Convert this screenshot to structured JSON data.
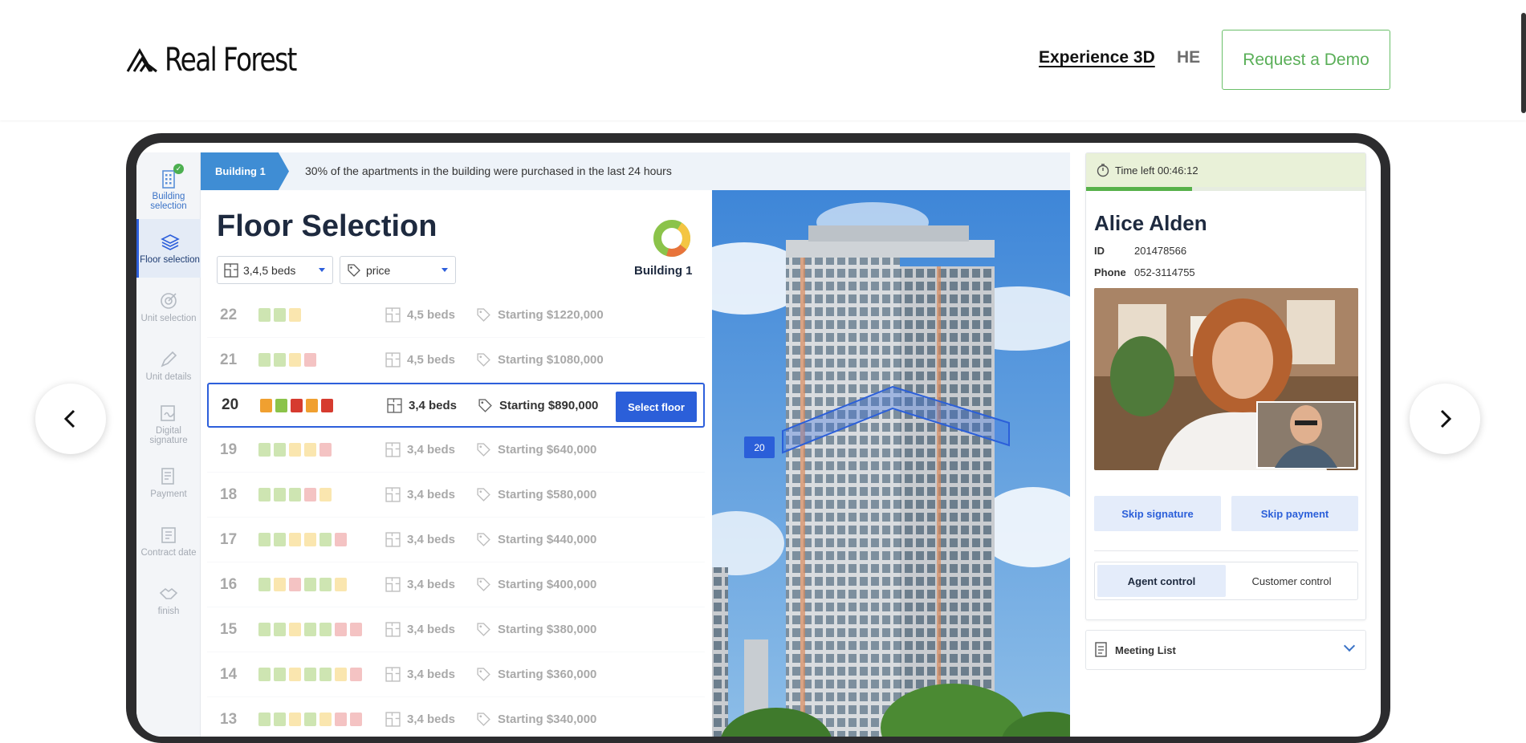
{
  "nav": {
    "brand": "Real Forest",
    "experience_link": "Experience 3D",
    "lang": "HE",
    "demo_button": "Request a Demo"
  },
  "steps": [
    {
      "label": "Building selection",
      "icon": "building-icon",
      "state": "done"
    },
    {
      "label": "Floor selection",
      "icon": "layers-icon",
      "state": "active"
    },
    {
      "label": "Unit selection",
      "icon": "target-icon",
      "state": "pending"
    },
    {
      "label": "Unit details",
      "icon": "pen-icon",
      "state": "pending"
    },
    {
      "label": "Digital signature",
      "icon": "signature-icon",
      "state": "pending"
    },
    {
      "label": "Payment",
      "icon": "payment-icon",
      "state": "pending"
    },
    {
      "label": "Contract date",
      "icon": "contract-icon",
      "state": "pending"
    },
    {
      "label": "finish",
      "icon": "handshake-icon",
      "state": "pending"
    }
  ],
  "announcement": {
    "building_tag": "Building 1",
    "text": "30% of the apartments in the building were purchased in the last 24 hours"
  },
  "floor_selection": {
    "title": "Floor Selection",
    "building_label": "Building 1",
    "filter_beds": "3,4,5 beds",
    "filter_price": "price",
    "select_button": "Select floor",
    "selected_floor": "20",
    "floors": [
      {
        "floor": "22",
        "beds": "4,5 beds",
        "price": "Starting $1220,000",
        "units": [
          "green",
          "green",
          "yellow"
        ]
      },
      {
        "floor": "21",
        "beds": "4,5 beds",
        "price": "Starting $1080,000",
        "units": [
          "green",
          "green",
          "yellow",
          "red"
        ]
      },
      {
        "floor": "20",
        "beds": "3,4 beds",
        "price": "Starting $890,000",
        "units": [
          "orange",
          "green",
          "darkred",
          "orange",
          "darkred"
        ]
      },
      {
        "floor": "19",
        "beds": "3,4 beds",
        "price": "Starting $640,000",
        "units": [
          "green",
          "green",
          "yellow",
          "yellow",
          "red"
        ]
      },
      {
        "floor": "18",
        "beds": "3,4 beds",
        "price": "Starting $580,000",
        "units": [
          "green",
          "green",
          "green",
          "red",
          "yellow"
        ]
      },
      {
        "floor": "17",
        "beds": "3,4 beds",
        "price": "Starting $440,000",
        "units": [
          "green",
          "green",
          "yellow",
          "yellow",
          "green",
          "red"
        ]
      },
      {
        "floor": "16",
        "beds": "3,4 beds",
        "price": "Starting $400,000",
        "units": [
          "green",
          "yellow",
          "red",
          "green",
          "green",
          "yellow"
        ]
      },
      {
        "floor": "15",
        "beds": "3,4 beds",
        "price": "Starting $380,000",
        "units": [
          "green",
          "green",
          "yellow",
          "green",
          "green",
          "red",
          "red"
        ]
      },
      {
        "floor": "14",
        "beds": "3,4 beds",
        "price": "Starting $360,000",
        "units": [
          "green",
          "green",
          "yellow",
          "green",
          "green",
          "yellow",
          "red"
        ]
      },
      {
        "floor": "13",
        "beds": "3,4 beds",
        "price": "Starting $340,000",
        "units": [
          "green",
          "green",
          "yellow",
          "green",
          "yellow",
          "red",
          "red"
        ]
      }
    ]
  },
  "building_view": {
    "floor_tag": "20"
  },
  "agent_panel": {
    "timer": "Time left 00:46:12",
    "timer_progress": 0.38,
    "customer_name": "Alice Alden",
    "id_label": "ID",
    "id_value": "201478566",
    "phone_label": "Phone",
    "phone_value": "052-3114755",
    "skip_signature": "Skip signature",
    "skip_payment": "Skip payment",
    "agent_control": "Agent control",
    "customer_control": "Customer control",
    "meeting_list": "Meeting List"
  },
  "colors": {
    "accent": "#2b5fd9",
    "demo_green": "#5aaf58",
    "green": "#8bc34a",
    "yellow": "#f4c542",
    "red": "#e57373",
    "orange": "#f0a030",
    "darkred": "#d63b2f"
  }
}
